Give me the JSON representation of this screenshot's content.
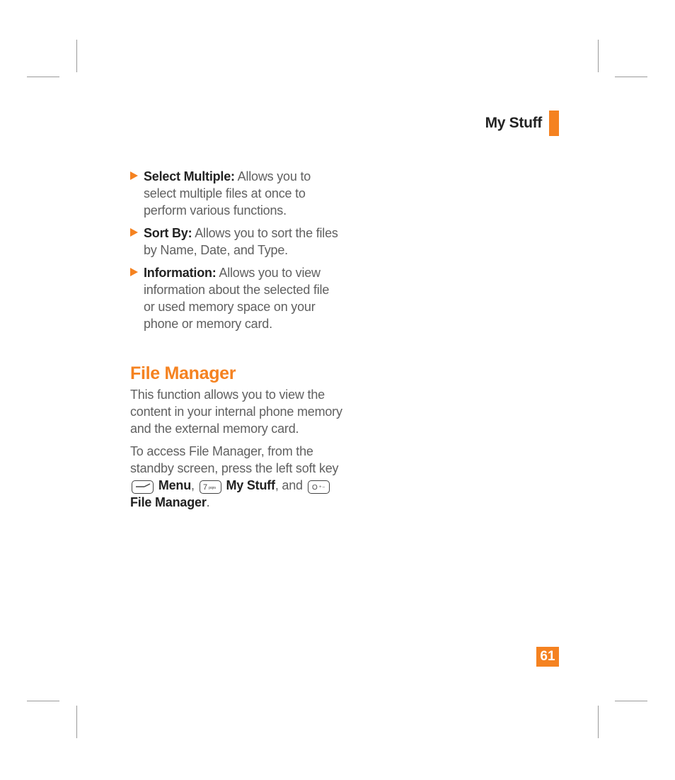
{
  "header": {
    "section_title": "My Stuff"
  },
  "bullets": [
    {
      "label": "Select Multiple:",
      "desc": " Allows you to select multiple files at once to perform various functions."
    },
    {
      "label": "Sort By:",
      "desc": " Allows you to sort the files by Name, Date, and Type."
    },
    {
      "label": "Information:",
      "desc": " Allows you to view information about the selected file or used memory space on your phone or memory card."
    }
  ],
  "file_manager": {
    "heading": "File Manager",
    "para1": "This function allows you to view the content in your internal phone memory and the external memory card.",
    "para2_pre": "To access File Manager, from the standby screen, press the left soft key ",
    "menu": "Menu",
    "comma1": ", ",
    "mystuff": "My Stuff",
    "comma2": ", and ",
    "filemanager": "File Manager",
    "period": "."
  },
  "keys": {
    "softkey": "left-soft-key",
    "seven": "7 pqrs",
    "zero": "0 +"
  },
  "page_number": "61"
}
